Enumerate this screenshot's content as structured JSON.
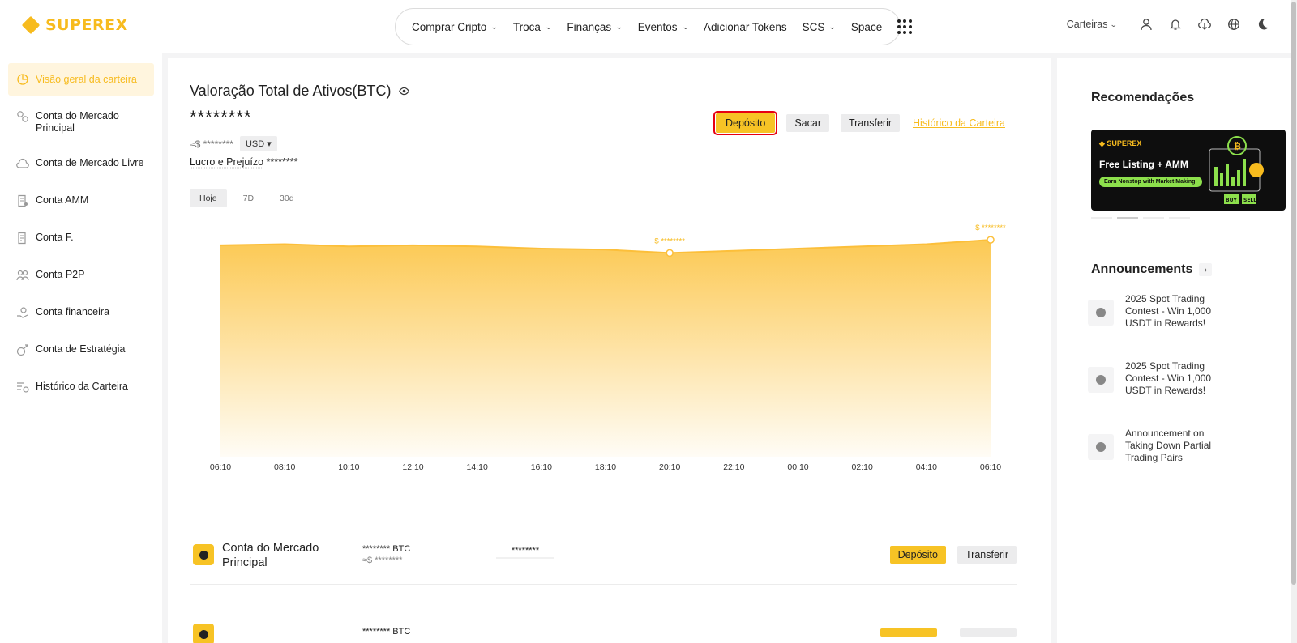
{
  "brand": {
    "name": "SUPEREX",
    "color": "#f7bb1e"
  },
  "topnav": {
    "items": [
      {
        "label": "Comprar Cripto",
        "dropdown": true
      },
      {
        "label": "Troca",
        "dropdown": true
      },
      {
        "label": "Finanças",
        "dropdown": true
      },
      {
        "label": "Eventos",
        "dropdown": true
      },
      {
        "label": "Adicionar Tokens",
        "dropdown": false
      },
      {
        "label": "SCS",
        "dropdown": true
      },
      {
        "label": "Space",
        "dropdown": false
      }
    ]
  },
  "header_right": {
    "wallets_label": "Carteiras",
    "icons": [
      "user-icon",
      "bell-icon",
      "download-icon",
      "globe-icon",
      "moon-icon"
    ]
  },
  "sidebar": {
    "items": [
      {
        "label": "Visão geral da carteira",
        "icon": "pie-chart-icon",
        "active": true
      },
      {
        "label": "Conta do Mercado Principal",
        "icon": "exchange-icon",
        "active": false
      },
      {
        "label": "Conta de Mercado Livre",
        "icon": "cloud-icon",
        "active": false
      },
      {
        "label": "Conta AMM",
        "icon": "document-star-icon",
        "active": false
      },
      {
        "label": "Conta F.",
        "icon": "document-chart-icon",
        "active": false
      },
      {
        "label": "Conta P2P",
        "icon": "users-icon",
        "active": false
      },
      {
        "label": "Conta financeira",
        "icon": "hand-coin-icon",
        "active": false
      },
      {
        "label": "Conta de Estratégia",
        "icon": "strategy-icon",
        "active": false
      },
      {
        "label": "Histórico da Carteira",
        "icon": "history-list-icon",
        "active": false
      }
    ]
  },
  "overview": {
    "title": "Valoração Total de Ativos(BTC)",
    "total_masked": "********",
    "fiat_masked": "≈$ ********",
    "currency": "USD",
    "pnl_label": "Lucro e Prejuízo",
    "pnl_value": "********",
    "actions": {
      "deposit": "Depósito",
      "withdraw": "Sacar",
      "transfer": "Transferir",
      "history": "Histórico da Carteira"
    },
    "range_tabs": [
      "Hoje",
      "7D",
      "30d"
    ],
    "active_range": "Hoje"
  },
  "chart_data": {
    "type": "area",
    "x": [
      "06:10",
      "08:10",
      "10:10",
      "12:10",
      "14:10",
      "16:10",
      "18:10",
      "20:10",
      "22:10",
      "00:10",
      "02:10",
      "04:10",
      "06:10"
    ],
    "series": [
      {
        "values": [
          0.96,
          0.965,
          0.955,
          0.96,
          0.955,
          0.945,
          0.94,
          0.925,
          0.935,
          0.945,
          0.955,
          0.965,
          0.985
        ]
      }
    ],
    "markers": [
      {
        "index": 7,
        "label": "$ ********"
      },
      {
        "index": 12,
        "label": "$ ********"
      }
    ],
    "fill_color": "#fcc64a",
    "line_color": "#fcbf3a"
  },
  "accounts": [
    {
      "name": "Conta do Mercado Principal",
      "balance": "******** BTC",
      "fiat": "≈$ ********",
      "mid": "********",
      "deposit": "Depósito",
      "transfer": "Transferir"
    }
  ],
  "next_account_peek": "******** BTC",
  "recommendations": {
    "title": "Recomendações",
    "banner": {
      "logo": "SUPEREX",
      "headline": "Free Listing + AMM",
      "pill": "Earn Nonstop with Market Making!",
      "buy": "BUY",
      "sell": "SELL"
    }
  },
  "announcements": {
    "title": "Announcements",
    "items": [
      {
        "text": "2025 Spot Trading Contest - Win 1,000 USDT in Rewards!"
      },
      {
        "text": "2025 Spot Trading Contest - Win 1,000 USDT in Rewards!"
      },
      {
        "text": "Announcement on Taking Down Partial Trading Pairs"
      }
    ]
  }
}
